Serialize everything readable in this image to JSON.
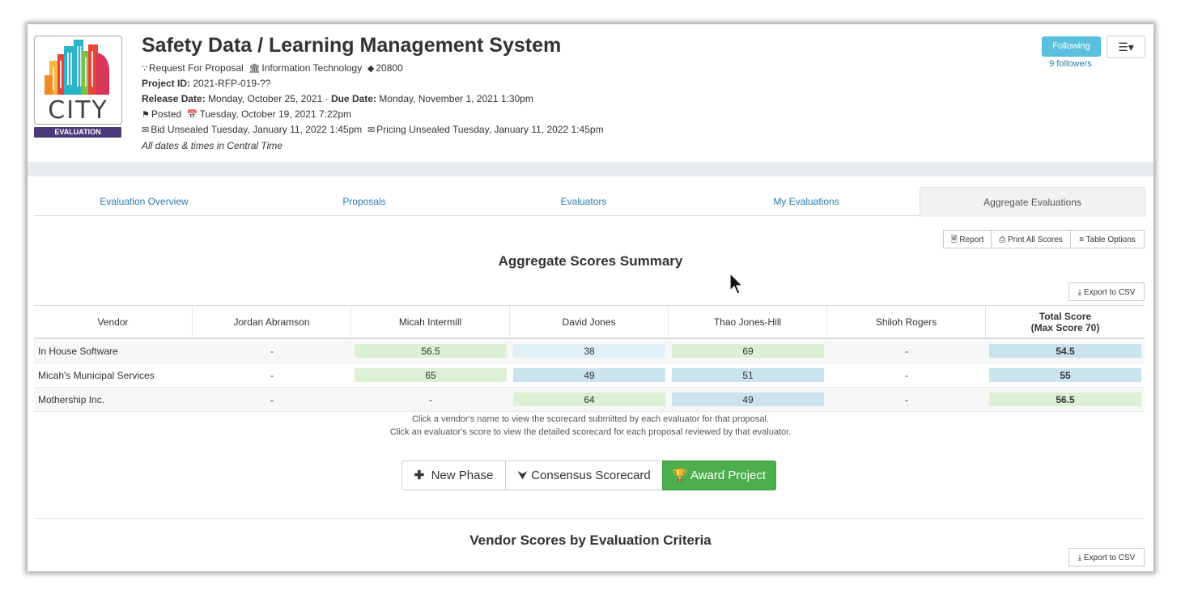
{
  "header": {
    "logo_word": "CITY",
    "logo_badge": "EVALUATION",
    "title": "Safety Data / Learning Management System",
    "type": "Request For Proposal",
    "department": "Information Technology",
    "tag": "20800",
    "project_id_label": "Project ID:",
    "project_id": "2021-RFP-019-??",
    "release_label": "Release Date:",
    "release_date": "Monday, October 25, 2021",
    "due_label": "Due Date:",
    "due_date": "Monday, November 1, 2021 1:30pm",
    "posted_label": "Posted",
    "posted_date": "Tuesday, October 19, 2021 7:22pm",
    "bid_unsealed": "Bid Unsealed Tuesday, January 11, 2022 1:45pm",
    "pricing_unsealed": "Pricing Unsealed Tuesday, January 11, 2022 1:45pm",
    "timezone_note": "All dates & times in Central Time",
    "following_label": "Following",
    "followers": "9 followers",
    "menu_icon": "list-icon"
  },
  "tabs": [
    {
      "label": "Evaluation Overview"
    },
    {
      "label": "Proposals"
    },
    {
      "label": "Evaluators"
    },
    {
      "label": "My Evaluations"
    },
    {
      "label": "Aggregate Evaluations",
      "active": true
    }
  ],
  "toolbar": {
    "report": "Report",
    "print_all": "Print All Scores",
    "table_options": "Table Options"
  },
  "summary": {
    "title": "Aggregate Scores Summary",
    "export": "Export to CSV",
    "columns": [
      "Vendor",
      "Jordan Abramson",
      "Micah Intermill",
      "David Jones",
      "Thao Jones-Hill",
      "Shiloh Rogers"
    ],
    "total_header_line1": "Total Score",
    "total_header_line2": "(Max Score 70)",
    "rows": [
      {
        "vendor": "In House Software",
        "scores": [
          "-",
          "56.5",
          "38",
          "69",
          "-"
        ],
        "total": "54.5"
      },
      {
        "vendor": "Micah's Municipal Services",
        "scores": [
          "-",
          "65",
          "49",
          "51",
          "-"
        ],
        "total": "55"
      },
      {
        "vendor": "Mothership Inc.",
        "scores": [
          "-",
          "-",
          "64",
          "49",
          "-"
        ],
        "total": "56.5"
      }
    ],
    "hint1": "Click a vendor's name to view the scorecard submitted by each evaluator for that proposal.",
    "hint2": "Click an evaluator's score to view the detailed scorecard for each proposal reviewed by that evaluator."
  },
  "actions": {
    "new_phase": "New Phase",
    "consensus": "Consensus Scorecard",
    "award": "Award Project"
  },
  "criteria": {
    "title": "Vendor Scores by Evaluation Criteria",
    "export": "Export to CSV"
  },
  "colors": {
    "green_cell": "#dcf0d4",
    "blue_cell": "#c9e3ef",
    "light_blue_cell": "#dff0f6",
    "award_green": "#4cae4c",
    "following_blue": "#5bc0de",
    "link_blue": "#2a7ab0"
  }
}
